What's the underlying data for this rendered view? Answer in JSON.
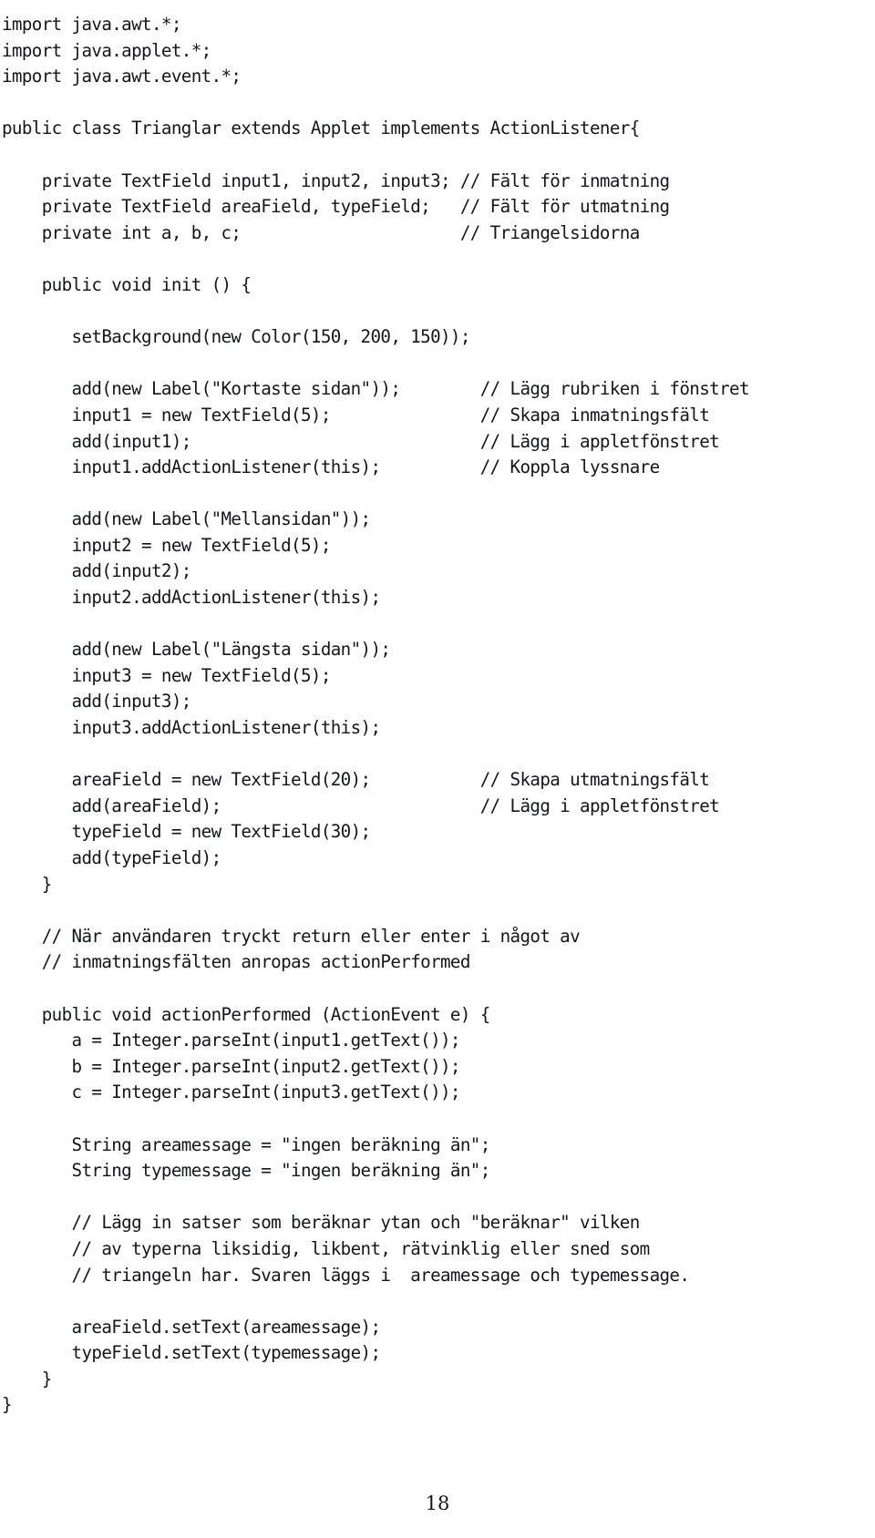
{
  "document": {
    "kind": "code-listing-page",
    "language": "Java",
    "page_number": "18",
    "text_color": "#15161a",
    "background_color": "#ffffff"
  },
  "listing": {
    "lines": [
      "import java.awt.*;",
      "import java.applet.*;",
      "import java.awt.event.*;",
      "",
      "public class Trianglar extends Applet implements ActionListener{",
      "",
      "    private TextField input1, input2, input3; // Fält för inmatning",
      "    private TextField areaField, typeField;   // Fält för utmatning",
      "    private int a, b, c;                      // Triangelsidorna",
      "",
      "    public void init () {",
      "",
      "       setBackground(new Color(150, 200, 150));",
      "",
      "       add(new Label(\"Kortaste sidan\"));        // Lägg rubriken i fönstret",
      "       input1 = new TextField(5);               // Skapa inmatningsfält",
      "       add(input1);                             // Lägg i appletfönstret",
      "       input1.addActionListener(this);          // Koppla lyssnare",
      "",
      "       add(new Label(\"Mellansidan\"));",
      "       input2 = new TextField(5);",
      "       add(input2);",
      "       input2.addActionListener(this);",
      "",
      "       add(new Label(\"Längsta sidan\"));",
      "       input3 = new TextField(5);",
      "       add(input3);",
      "       input3.addActionListener(this);",
      "",
      "       areaField = new TextField(20);           // Skapa utmatningsfält",
      "       add(areaField);                          // Lägg i appletfönstret",
      "       typeField = new TextField(30);",
      "       add(typeField);",
      "    }",
      "",
      "    // När användaren tryckt return eller enter i något av",
      "    // inmatningsfälten anropas actionPerformed",
      "",
      "    public void actionPerformed (ActionEvent e) {",
      "       a = Integer.parseInt(input1.getText());",
      "       b = Integer.parseInt(input2.getText());",
      "       c = Integer.parseInt(input3.getText());",
      "",
      "       String areamessage = \"ingen beräkning än\";",
      "       String typemessage = \"ingen beräkning än\";",
      "",
      "       // Lägg in satser som beräknar ytan och \"beräknar\" vilken",
      "       // av typerna liksidig, likbent, rätvinklig eller sned som",
      "       // triangeln har. Svaren läggs i  areamessage och typemessage.",
      "",
      "       areaField.setText(areamessage);",
      "       typeField.setText(typemessage);",
      "    }",
      "}"
    ]
  },
  "footer": {
    "page_label": "18"
  }
}
